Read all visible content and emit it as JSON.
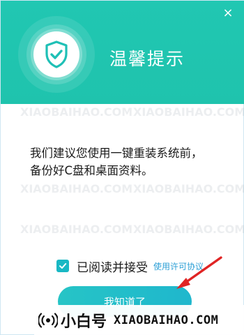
{
  "dialog": {
    "title": "温馨提示",
    "close_glyph": "×",
    "message_line1": "我们建议您使用一键重装系统前，",
    "message_line2": "备份好C盘和桌面资料。",
    "agree_label": "已阅读并接受",
    "agree_link": "使用许可协议",
    "agree_checked": true,
    "ok_button": "我知道了"
  },
  "watermark": {
    "name": "小白号",
    "site": "XIAOBAIHAO.COM",
    "faint_text": "XIAOBAIHAO.COM"
  },
  "colors": {
    "header": "#21c7b2",
    "accent": "#19b8c4",
    "link": "#2c9fd6",
    "arrow": "#e02424"
  },
  "icons": {
    "shield": "shield-check-icon",
    "check": "checkmark-icon",
    "close": "close-icon",
    "arrow": "red-arrow-icon",
    "watermark": "broadcast-icon"
  }
}
